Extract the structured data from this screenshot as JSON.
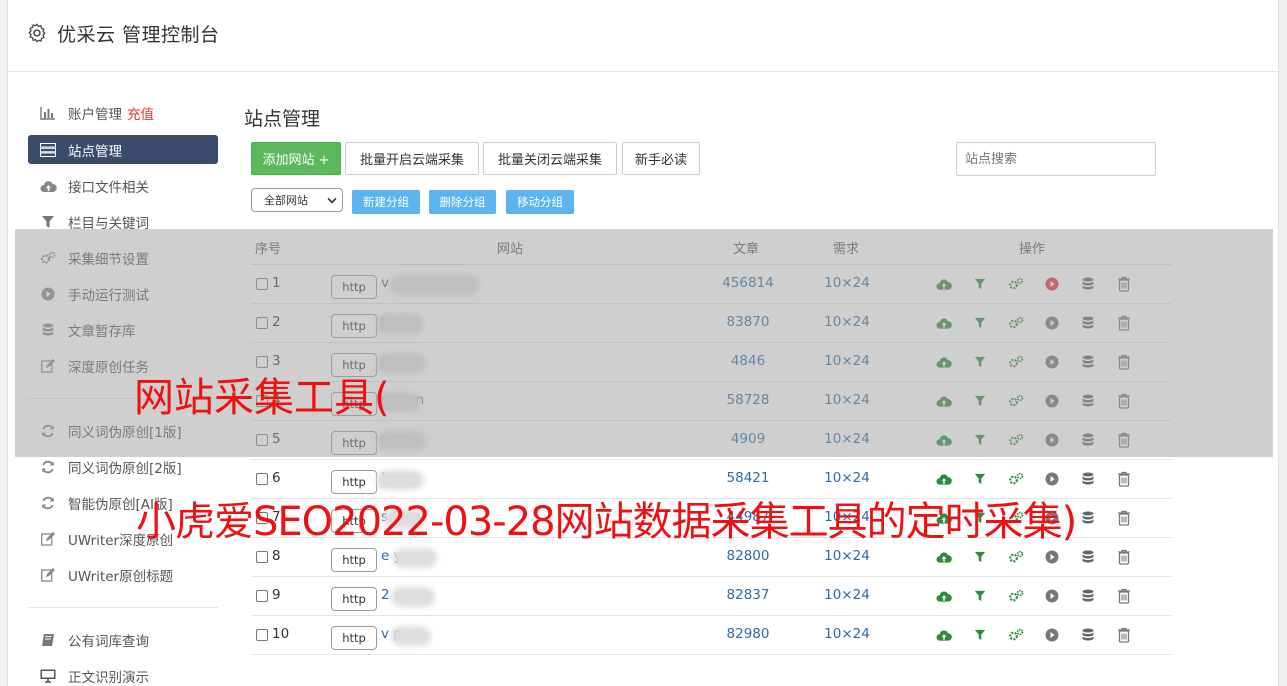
{
  "app": {
    "title": "优采云 管理控制台"
  },
  "sidebar": {
    "items": [
      {
        "label": "账户管理",
        "extra": "充值",
        "icon": "bar-chart-icon"
      },
      {
        "label": "站点管理",
        "icon": "server-icon",
        "active": true
      },
      {
        "label": "接口文件相关",
        "icon": "cloud-upload-icon"
      },
      {
        "label": "栏目与关键词",
        "icon": "filter-icon"
      },
      {
        "label": "采集细节设置",
        "icon": "gears-icon"
      },
      {
        "label": "手动运行测试",
        "icon": "play-circle-icon"
      },
      {
        "label": "文章暂存库",
        "icon": "database-icon"
      },
      {
        "label": "深度原创任务",
        "icon": "edit-icon"
      }
    ],
    "items2": [
      {
        "label": "同义词伪原创[1版]",
        "icon": "refresh-icon"
      },
      {
        "label": "同义词伪原创[2版]",
        "icon": "refresh-icon"
      },
      {
        "label": "智能伪原创[AI版]",
        "icon": "refresh-icon"
      },
      {
        "label": "UWriter深度原创",
        "icon": "edit-icon"
      },
      {
        "label": "UWriter原创标题",
        "icon": "edit-icon"
      }
    ],
    "items3": [
      {
        "label": "公有词库查询",
        "icon": "book-icon"
      },
      {
        "label": "正文识别演示",
        "icon": "monitor-icon"
      }
    ]
  },
  "main": {
    "title": "站点管理",
    "buttons": {
      "add": "添加网站 +",
      "batch_on": "批量开启云端采集",
      "batch_off": "批量关闭云端采集",
      "guide": "新手必读"
    },
    "search_placeholder": "站点搜索",
    "group_select": "全部网站",
    "group_buttons": {
      "new": "新建分组",
      "delete": "删除分组",
      "move": "移动分组"
    },
    "table": {
      "headers": {
        "no": "序号",
        "site": "网站",
        "articles": "文章",
        "demand": "需求",
        "ops": "操作"
      },
      "rows": [
        {
          "no": "1",
          "proto": "http",
          "site": "v            .com",
          "articles": "456814",
          "demand": "10×24",
          "active": true
        },
        {
          "no": "2",
          "proto": "http",
          "site": "         tt.cn",
          "articles": "83870",
          "demand": "10×24",
          "active": false
        },
        {
          "no": "3",
          "proto": "http",
          "site": "          ni.cn",
          "articles": "4846",
          "demand": "10×24",
          "active": false
        },
        {
          "no": "4",
          "proto": "http",
          "site": "          pay.cn",
          "articles": "58728",
          "demand": "10×24",
          "active": false
        },
        {
          "no": "5",
          "proto": "http",
          "site": "          s.cn",
          "articles": "4909",
          "demand": "10×24",
          "active": false
        },
        {
          "no": "6",
          "proto": "http",
          "site": "          k.cn",
          "articles": "58421",
          "demand": "10×24",
          "active": false
        },
        {
          "no": "7",
          "proto": "http",
          "site": "s       9.cn",
          "articles": "44987",
          "demand": "10×24",
          "active": false
        },
        {
          "no": "8",
          "proto": "http",
          "site": "e        y.cn",
          "articles": "82800",
          "demand": "10×24",
          "active": false
        },
        {
          "no": "9",
          "proto": "http",
          "site": "2         az.cn",
          "articles": "82837",
          "demand": "10×24",
          "active": false
        },
        {
          "no": "10",
          "proto": "http",
          "site": "v         p.cn",
          "articles": "82980",
          "demand": "10×24",
          "active": false
        }
      ]
    }
  },
  "watermark": {
    "line1": "网站采集工具(",
    "line2": "小虎爱SEO2022-03-28网站数据采集工具的定时采集)"
  },
  "colors": {
    "accent": "#3a4b6b",
    "green": "#5cb85c",
    "link": "#2c6aa8",
    "watermark": "#ee1111"
  }
}
